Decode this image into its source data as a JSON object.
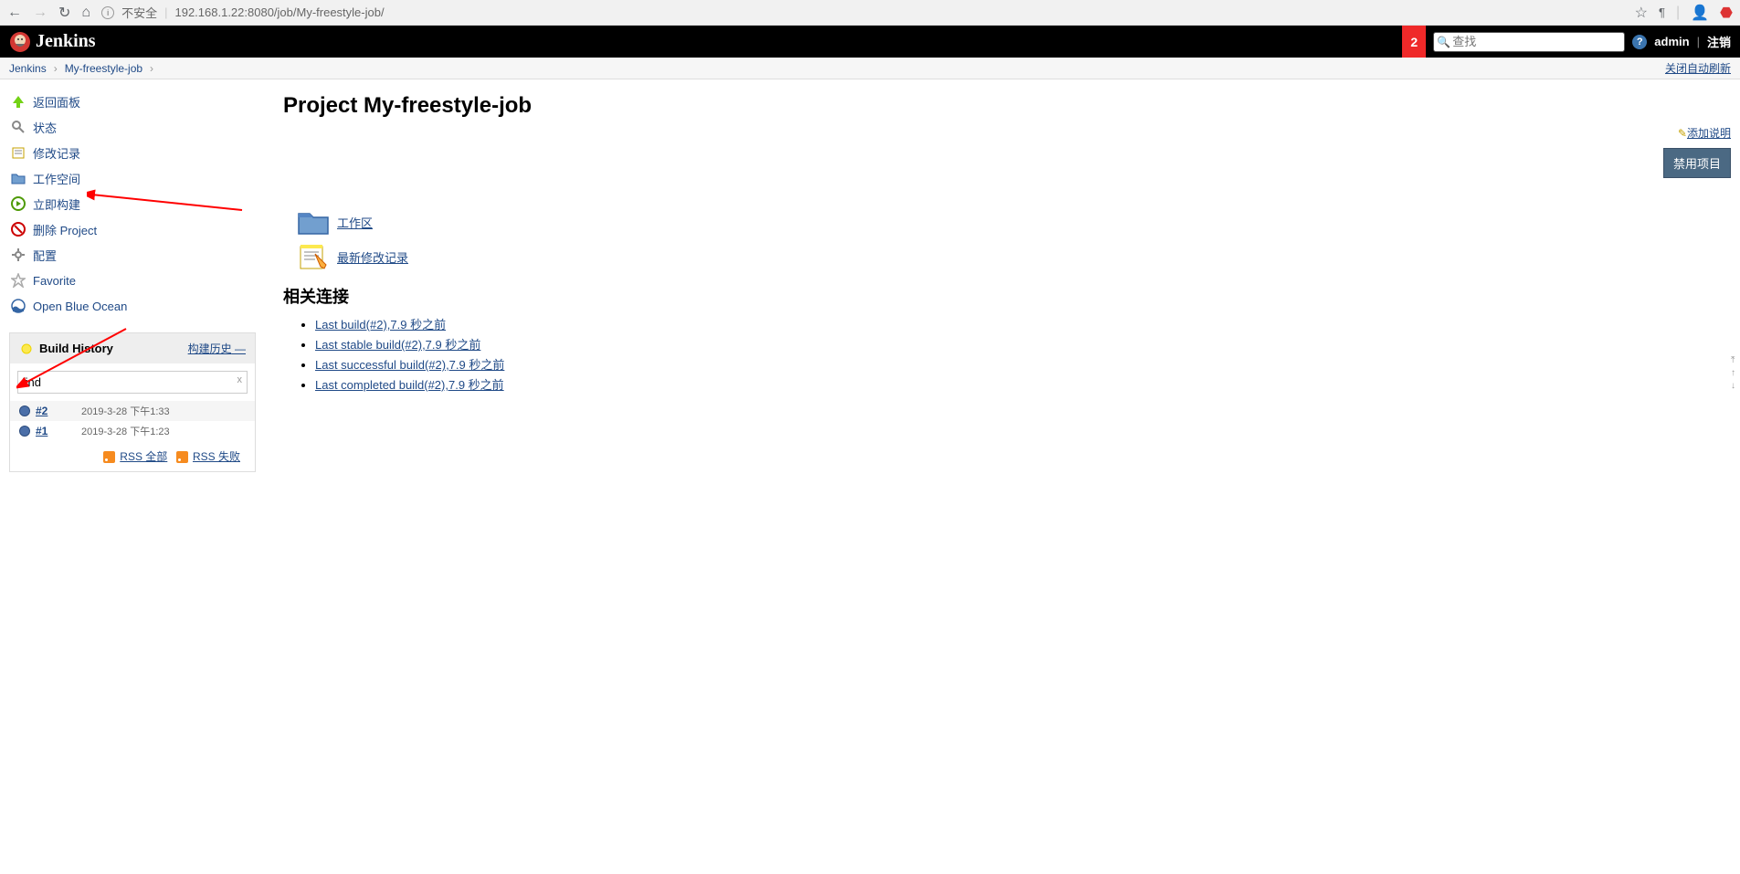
{
  "browser": {
    "insecure_label": "不安全",
    "url": "192.168.1.22:8080/job/My-freestyle-job/"
  },
  "header": {
    "logo": "Jenkins",
    "notif_count": "2",
    "search_placeholder": "查找",
    "admin": "admin",
    "logout": "注销"
  },
  "breadcrumb": {
    "root": "Jenkins",
    "job": "My-freestyle-job",
    "auto_refresh": "关闭自动刷新"
  },
  "tasks": {
    "back": "返回面板",
    "status": "状态",
    "changes": "修改记录",
    "workspace": "工作空间",
    "build_now": "立即构建",
    "delete": "删除 Project",
    "configure": "配置",
    "favorite": "Favorite",
    "blue_ocean": "Open Blue Ocean"
  },
  "build_history": {
    "title": "Build History",
    "trend": "构建历史",
    "find_value": "find",
    "builds": [
      {
        "num": "#2",
        "date": "2019-3-28 下午1:33"
      },
      {
        "num": "#1",
        "date": "2019-3-28 下午1:23"
      }
    ],
    "rss_all": "RSS 全部",
    "rss_fail": "RSS 失败"
  },
  "main": {
    "title": "Project My-freestyle-job",
    "add_description": "添加说明",
    "disable": "禁用项目",
    "workspace_link": "工作区",
    "changes_link": "最新修改记录",
    "related_title": "相关连接",
    "related": [
      "Last build(#2),7.9 秒之前",
      "Last stable build(#2),7.9 秒之前",
      "Last successful build(#2),7.9 秒之前",
      "Last completed build(#2),7.9 秒之前"
    ]
  }
}
